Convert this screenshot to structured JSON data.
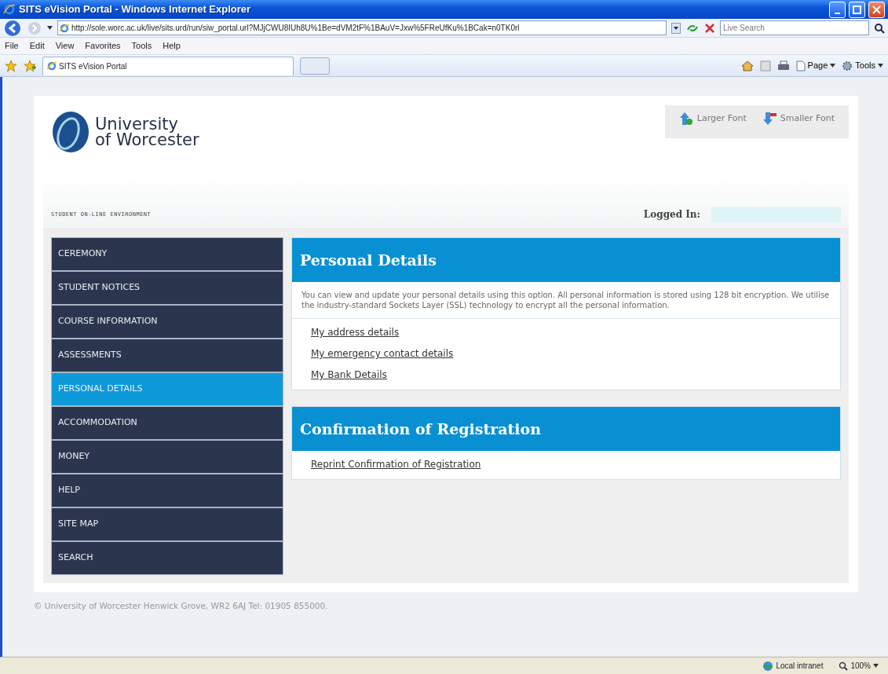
{
  "window": {
    "title": "SITS eVision Portal - Windows Internet Explorer"
  },
  "address_bar": {
    "url": "http://sole.worc.ac.uk/live/sits.urd/run/siw_portal.url?MJjCWU8IUh8U%1Be=dVM2tF%1BAuV=Jxw%5FReUfKu%1BCak=n0TK0rl"
  },
  "search": {
    "placeholder": "Live Search"
  },
  "menu": [
    "File",
    "Edit",
    "View",
    "Favorites",
    "Tools",
    "Help"
  ],
  "tabs": [
    {
      "label": "SITS eVision Portal",
      "selected": true
    }
  ],
  "command_bar": [
    "Page",
    "Tools"
  ],
  "site": {
    "logo_lines": [
      "University",
      "of Worcester"
    ],
    "font_buttons": [
      {
        "kind": "larger",
        "label": "Larger Font"
      },
      {
        "kind": "smaller",
        "label": "Smaller Font"
      }
    ],
    "tagline": "STUDENT ON-LINE ENVIRONMENT",
    "logged_in": "Logged In:"
  },
  "nav": [
    {
      "label": "CEREMONY",
      "selected": false
    },
    {
      "label": "STUDENT NOTICES",
      "selected": false
    },
    {
      "label": "COURSE INFORMATION",
      "selected": false
    },
    {
      "label": "ASSESSMENTS",
      "selected": false
    },
    {
      "label": "PERSONAL DETAILS",
      "selected": true
    },
    {
      "label": "ACCOMMODATION",
      "selected": false
    },
    {
      "label": "MONEY",
      "selected": false
    },
    {
      "label": "HELP",
      "selected": false
    },
    {
      "label": "SITE MAP",
      "selected": false
    },
    {
      "label": "SEARCH",
      "selected": false
    }
  ],
  "panels": [
    {
      "title": "Personal Details",
      "description": "You can view and update your personal details using this option. All personal information is stored using 128 bit encryption. We utilise the industry-standard Sockets Layer (SSL) technology to encrypt all the personal information.",
      "links": [
        "My address details",
        "My emergency contact details",
        "My Bank Details"
      ]
    },
    {
      "title": "Confirmation of Registration",
      "links": [
        "Reprint Confirmation of Registration"
      ]
    }
  ],
  "footer": "© University of Worcester Henwick Grove, WR2 6AJ Tel: 01905 855000.",
  "status_bar": {
    "zone": "Local intranet",
    "zoom": "100%"
  }
}
